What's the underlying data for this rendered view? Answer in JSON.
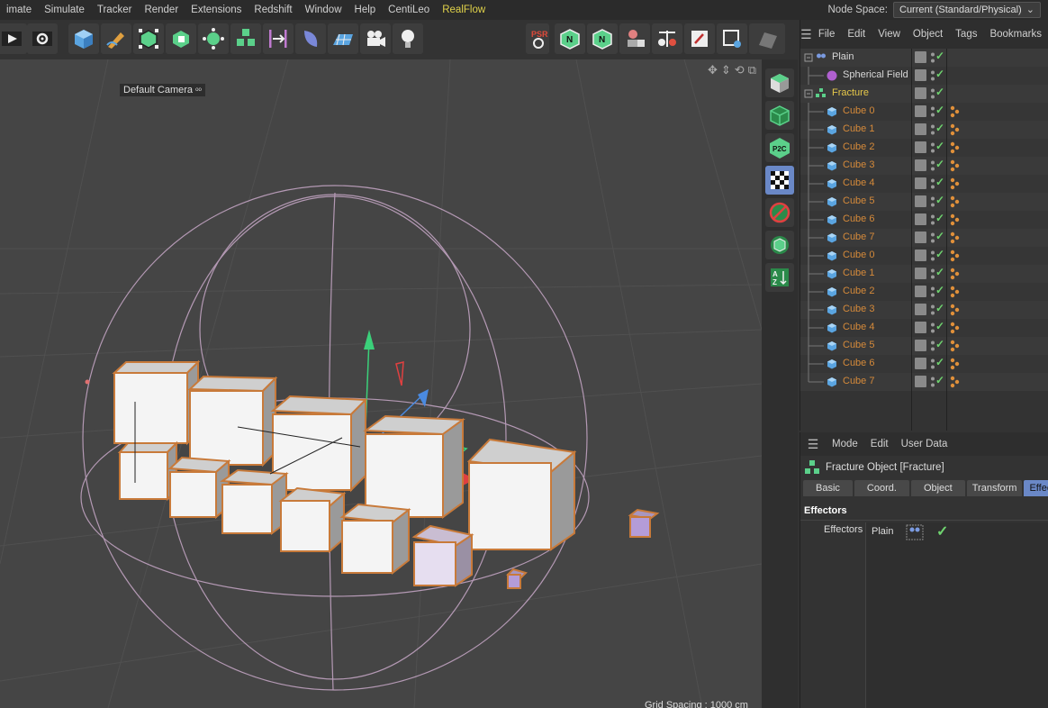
{
  "menubar": {
    "items": [
      "imate",
      "Simulate",
      "Tracker",
      "Render",
      "Extensions",
      "Redshift",
      "Window",
      "Help",
      "CentiLeo",
      "RealFlow"
    ],
    "node_space_label": "Node Space:",
    "node_space_value": "Current (Standard/Physical)"
  },
  "toolbar": {
    "icons": [
      "render-view-icon",
      "render-settings-icon",
      "cube-icon",
      "pen-icon",
      "subdivision-icon",
      "extrude-icon",
      "cloner-icon",
      "mograph-icon",
      "spline-icon",
      "deformer-icon",
      "floor-icon",
      "camera-icon",
      "light-icon"
    ],
    "right_icons": [
      "psr-icon",
      "node-icon",
      "node-edit-icon",
      "person-icon",
      "scale-icon",
      "edit-icon",
      "selection-icon",
      "grid-icon"
    ],
    "psr_label": "PSR"
  },
  "viewport": {
    "camera_label": "Default Camera",
    "grid_spacing": "Grid Spacing : 1000 cm"
  },
  "palette": {
    "icons": [
      "view-cube-icon",
      "wireframe-cube-icon",
      "p2c-icon",
      "checker-icon",
      "no-render-icon",
      "render-tag-icon",
      "sort-az-icon"
    ],
    "p2c_label": "P2C"
  },
  "object_manager": {
    "menu": [
      "File",
      "Edit",
      "View",
      "Object",
      "Tags",
      "Bookmarks"
    ],
    "rows": [
      {
        "name": "Plain",
        "style": "white",
        "indent": 0,
        "icon": "plain-effector-icon",
        "tag": false
      },
      {
        "name": "Spherical Field",
        "style": "white",
        "indent": 1,
        "icon": "spherical-field-icon",
        "tag": false
      },
      {
        "name": "Fracture",
        "style": "yellow",
        "indent": 0,
        "icon": "fracture-icon",
        "tag": false
      },
      {
        "name": "Cube 0",
        "style": "orange",
        "indent": 1,
        "icon": "cube-icon",
        "tag": true
      },
      {
        "name": "Cube 1",
        "style": "orange",
        "indent": 1,
        "icon": "cube-icon",
        "tag": true
      },
      {
        "name": "Cube 2",
        "style": "orange",
        "indent": 1,
        "icon": "cube-icon",
        "tag": true
      },
      {
        "name": "Cube 3",
        "style": "orange",
        "indent": 1,
        "icon": "cube-icon",
        "tag": true
      },
      {
        "name": "Cube 4",
        "style": "orange",
        "indent": 1,
        "icon": "cube-icon",
        "tag": true
      },
      {
        "name": "Cube 5",
        "style": "orange",
        "indent": 1,
        "icon": "cube-icon",
        "tag": true
      },
      {
        "name": "Cube 6",
        "style": "orange",
        "indent": 1,
        "icon": "cube-icon",
        "tag": true
      },
      {
        "name": "Cube 7",
        "style": "orange",
        "indent": 1,
        "icon": "cube-icon",
        "tag": true
      },
      {
        "name": "Cube 0",
        "style": "orange",
        "indent": 1,
        "icon": "cube-icon",
        "tag": true
      },
      {
        "name": "Cube 1",
        "style": "orange",
        "indent": 1,
        "icon": "cube-icon",
        "tag": true
      },
      {
        "name": "Cube 2",
        "style": "orange",
        "indent": 1,
        "icon": "cube-icon",
        "tag": true
      },
      {
        "name": "Cube 3",
        "style": "orange",
        "indent": 1,
        "icon": "cube-icon",
        "tag": true
      },
      {
        "name": "Cube 4",
        "style": "orange",
        "indent": 1,
        "icon": "cube-icon",
        "tag": true
      },
      {
        "name": "Cube 5",
        "style": "orange",
        "indent": 1,
        "icon": "cube-icon",
        "tag": true
      },
      {
        "name": "Cube 6",
        "style": "orange",
        "indent": 1,
        "icon": "cube-icon",
        "tag": true
      },
      {
        "name": "Cube 7",
        "style": "orange",
        "indent": 1,
        "icon": "cube-icon",
        "tag": true
      }
    ]
  },
  "attribute_manager": {
    "menu": [
      "Mode",
      "Edit",
      "User Data"
    ],
    "title": "Fracture Object [Fracture]",
    "tabs": [
      "Basic",
      "Coord.",
      "Object",
      "Transform",
      "Effectors"
    ],
    "active_tab": "Effectors",
    "section": "Effectors",
    "field_label": "Effectors",
    "field_item": "Plain"
  },
  "colors": {
    "accent_tab": "#6a88c7",
    "object_orange": "#d58a3a",
    "object_yellow": "#e6c84a",
    "check_green": "#6fd36f"
  }
}
